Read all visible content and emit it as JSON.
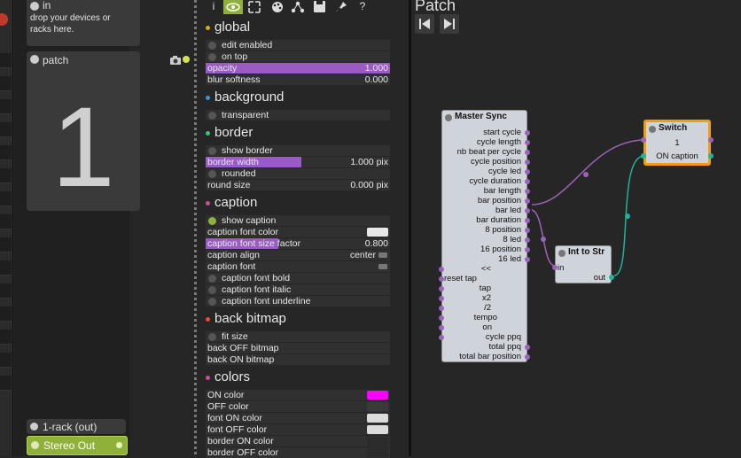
{
  "rack": {
    "in_title": "in",
    "in_desc_1": "drop your devices or",
    "in_desc_2": "racks here.",
    "patch_title": "patch",
    "patch_display": "1",
    "rack_out_title": "1-rack (out)",
    "stereo_out_label": "Stereo Out"
  },
  "toolbar": {
    "icons": [
      "info-icon",
      "eye-icon",
      "expand-icon",
      "palette-icon",
      "graph-icon",
      "save-icon",
      "pin-icon",
      "help-icon"
    ],
    "labels": {
      "info": "i",
      "help": "?"
    }
  },
  "inspector": {
    "global": {
      "title": "global",
      "edit_enabled": "edit enabled",
      "on_top": "on top",
      "opacity_label": "opacity",
      "opacity_value": "1.000",
      "blur_label": "blur softness",
      "blur_value": "0.000"
    },
    "background": {
      "title": "background",
      "transparent": "transparent"
    },
    "border": {
      "title": "border",
      "show_border": "show border",
      "border_width_label": "border width",
      "border_width_value": "1.000 pix",
      "rounded": "rounded",
      "round_size_label": "round size",
      "round_size_value": "0.000 pix"
    },
    "caption": {
      "title": "caption",
      "show_caption": "show caption",
      "font_color": "caption font color",
      "font_size_a": "caption font size",
      "font_size_b": " factor",
      "font_size_value": "0.800",
      "align_label": "caption align",
      "align_value": "center",
      "font_label": "caption font",
      "bold": "caption font bold",
      "italic": "caption font italic",
      "underline": "caption font underline"
    },
    "back_bitmap": {
      "title": "back bitmap",
      "fit_size": "fit size",
      "off_bitmap": "back OFF bitmap",
      "on_bitmap": "back ON bitmap"
    },
    "colors": {
      "title": "colors",
      "on_color": "ON color",
      "off_color": "OFF color",
      "font_on": "font ON color",
      "font_off": "font OFF color",
      "border_on": "border ON color",
      "border_off": "border OFF color"
    }
  },
  "patch": {
    "title": "Patch",
    "master_sync": {
      "title": "Master Sync",
      "outputs": [
        "start cycle",
        "cycle length",
        "nb beat per cycle",
        "cycle position",
        "cycle led",
        "cycle duration",
        "bar length",
        "bar position",
        "bar led",
        "bar duration",
        "8 position",
        "8 led",
        "16 position",
        "16 led"
      ],
      "inputs": [
        "<<",
        "reset tap",
        "tap",
        "x2",
        "/2",
        "tempo",
        "on",
        "cycle ppq",
        "total ppq",
        "total bar position"
      ]
    },
    "switch": {
      "title": "Switch",
      "value": "1",
      "caption": "ON caption"
    },
    "int_to_str": {
      "title": "Int to Str",
      "in": "in",
      "out": "out"
    }
  },
  "colors": {
    "accent_purple": "#9a5cc4",
    "on_color": "#ff00ff",
    "switch_border": "#f39c12",
    "wire_purple": "#9a62b9",
    "wire_teal": "#1ab59a"
  }
}
